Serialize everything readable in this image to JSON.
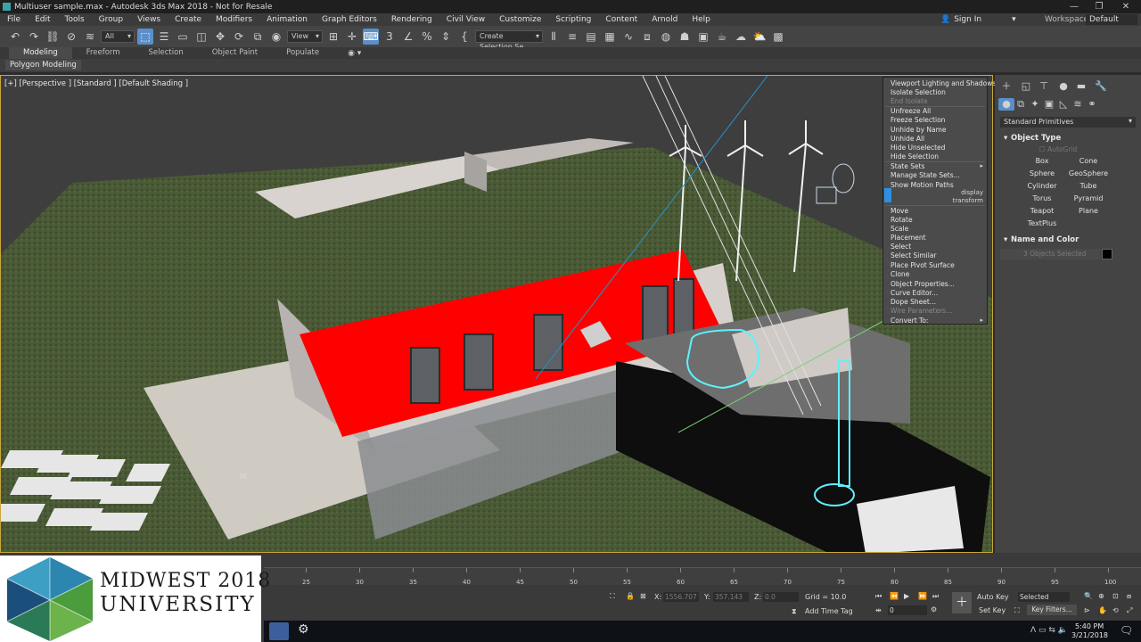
{
  "window": {
    "title": "Multiuser sample.max - Autodesk 3ds Max 2018 - Not for Resale",
    "controls": [
      "—",
      "❐",
      "✕"
    ]
  },
  "menubar": {
    "items": [
      "File",
      "Edit",
      "Tools",
      "Group",
      "Views",
      "Create",
      "Modifiers",
      "Animation",
      "Graph Editors",
      "Rendering",
      "Civil View",
      "Customize",
      "Scripting",
      "Content",
      "Arnold",
      "Help"
    ],
    "sign_in": "Sign In",
    "workspaces_label": "Workspaces:",
    "workspaces_value": "Default"
  },
  "toolbar": {
    "filter_value": "All",
    "view_value": "View",
    "selection_set_value": "Create Selection Se"
  },
  "ribbon": {
    "tabs": [
      "Modeling",
      "Freeform",
      "Selection",
      "Object Paint",
      "Populate"
    ],
    "active_tab": "Modeling",
    "sub_label": "Polygon Modeling"
  },
  "viewport": {
    "label": "[+] [Perspective ] [Standard ] [Default Shading ]",
    "roof_color": "#ff0000",
    "selection_color": "#5ff0ff",
    "border_color": "#c9a83a"
  },
  "quad_menu": {
    "top_header": "display",
    "bottom_header": "transform",
    "display_items": [
      {
        "label": "Viewport Lighting and Shadows",
        "enabled": true
      },
      {
        "label": "Isolate Selection",
        "enabled": true
      },
      {
        "label": "End Isolate",
        "enabled": false
      },
      {
        "label": "Unfreeze All",
        "enabled": true
      },
      {
        "label": "Freeze Selection",
        "enabled": true
      },
      {
        "label": "Unhide by Name",
        "enabled": true
      },
      {
        "label": "Unhide All",
        "enabled": true
      },
      {
        "label": "Hide Unselected",
        "enabled": true
      },
      {
        "label": "Hide Selection",
        "enabled": true
      },
      {
        "label": "State Sets",
        "enabled": true
      },
      {
        "label": "Manage State Sets...",
        "enabled": true
      },
      {
        "label": "Show Motion Paths",
        "enabled": true
      }
    ],
    "transform_items": [
      {
        "label": "Move",
        "enabled": true
      },
      {
        "label": "Rotate",
        "enabled": true
      },
      {
        "label": "Scale",
        "enabled": true
      },
      {
        "label": "Placement",
        "enabled": true
      },
      {
        "label": "Select",
        "enabled": true
      },
      {
        "label": "Select Similar",
        "enabled": true
      },
      {
        "label": "Place Pivot Surface",
        "enabled": true
      },
      {
        "label": "Clone",
        "enabled": true
      },
      {
        "label": "Object Properties...",
        "enabled": true
      },
      {
        "label": "Curve Editor...",
        "enabled": true
      },
      {
        "label": "Dope Sheet...",
        "enabled": true
      },
      {
        "label": "Wire Parameters...",
        "enabled": false
      },
      {
        "label": "Convert To:",
        "enabled": true
      }
    ]
  },
  "command_panel": {
    "category": "Standard Primitives",
    "object_type_title": "Object Type",
    "autogrid": "AutoGrid",
    "primitives": [
      "Box",
      "Cone",
      "Sphere",
      "GeoSphere",
      "Cylinder",
      "Tube",
      "Torus",
      "Pyramid",
      "Teapot",
      "Plane",
      "TextPlus"
    ],
    "name_color_title": "Name and Color",
    "name_value": "3 Objects Selected",
    "object_color": "#000000"
  },
  "timeline": {
    "ticks": [
      "25",
      "30",
      "35",
      "40",
      "45",
      "50",
      "55",
      "60",
      "65",
      "70",
      "75",
      "80",
      "85",
      "90",
      "95",
      "100"
    ]
  },
  "status": {
    "x_label": "X:",
    "x_value": "1556.707",
    "y_label": "Y:",
    "y_value": "357.143",
    "z_label": "Z:",
    "z_value": "0.0",
    "grid": "Grid = 10.0",
    "add_time_tag": "Add Time Tag",
    "frame_value": "0",
    "auto_key": "Auto Key",
    "set_key": "Set Key",
    "selected_value": "Selected",
    "key_filters": "Key Filters..."
  },
  "logo": {
    "line1": "MIDWEST 2018",
    "line2": "UNIVERSITY"
  },
  "taskbar": {
    "time": "5:40 PM",
    "date": "3/21/2018"
  }
}
